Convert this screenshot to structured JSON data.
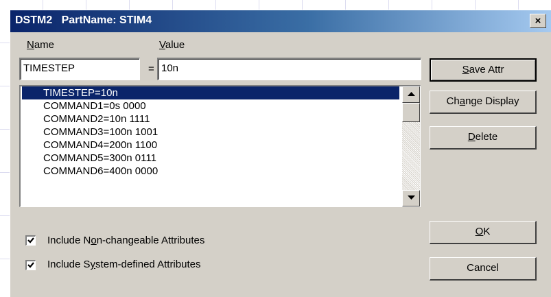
{
  "window": {
    "title": "DSTM2   PartName: STIM4",
    "close_glyph": "×"
  },
  "fields": {
    "name_label_mnemonic": "N",
    "name_label_rest": "ame",
    "value_label_mnemonic": "V",
    "value_label_rest": "alue",
    "name_value": "TIMESTEP",
    "equals": "=",
    "value_value": "10n"
  },
  "list": {
    "items": [
      "TIMESTEP=10n",
      "COMMAND1=0s 0000",
      "COMMAND2=10n 1111",
      "COMMAND3=100n 1001",
      "COMMAND4=200n 1100",
      "COMMAND5=300n 0111",
      "COMMAND6=400n 0000"
    ],
    "selected_index": 0
  },
  "buttons": {
    "save_attr_m": "S",
    "save_attr_rest": "ave Attr",
    "change_display_pre": "Ch",
    "change_display_m": "a",
    "change_display_rest": "nge Display",
    "delete_m": "D",
    "delete_rest": "elete",
    "ok_m": "O",
    "ok_rest": "K",
    "cancel": "Cancel"
  },
  "checkboxes": {
    "non_changeable_pre": "Include N",
    "non_changeable_m": "o",
    "non_changeable_rest": "n-changeable Attributes",
    "non_changeable_checked": true,
    "system_pre": "Include S",
    "system_m": "y",
    "system_rest": "stem-defined Attributes",
    "system_checked": true
  },
  "colors": {
    "title_bar_start": "#0a246a",
    "title_bar_end": "#a6caf0",
    "dialog_face": "#d4d0c8",
    "selection": "#0a246a"
  },
  "icons": {
    "close": "close-icon",
    "scroll_up": "scroll-up-arrow-icon",
    "scroll_down": "scroll-down-arrow-icon",
    "check": "checkmark-icon"
  }
}
